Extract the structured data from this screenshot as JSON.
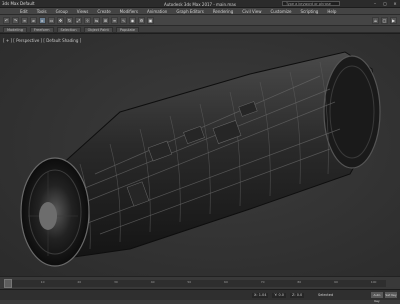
{
  "window": {
    "app_label": "3ds Max Default",
    "title": "Autodesk 3ds Max 2017 - main.max",
    "search_placeholder": "Type a keyword or phrase"
  },
  "menu": {
    "items": [
      "Edit",
      "Tools",
      "Group",
      "Views",
      "Create",
      "Modifiers",
      "Animation",
      "Graph Editors",
      "Rendering",
      "Civil View",
      "Customize",
      "Scripting",
      "Help"
    ]
  },
  "toolbar": {
    "tools": [
      {
        "icon": "undo-icon",
        "glyph": "↶"
      },
      {
        "icon": "redo-icon",
        "glyph": "↷"
      },
      {
        "icon": "link-icon",
        "glyph": "∞"
      },
      {
        "icon": "unlink-icon",
        "glyph": "⌀"
      },
      {
        "icon": "select-icon",
        "glyph": "▸"
      },
      {
        "icon": "select-region-icon",
        "glyph": "▭"
      },
      {
        "icon": "move-icon",
        "glyph": "✥"
      },
      {
        "icon": "rotate-icon",
        "glyph": "↻"
      },
      {
        "icon": "scale-icon",
        "glyph": "⤢"
      },
      {
        "icon": "snap-icon",
        "glyph": "⊹"
      },
      {
        "icon": "mirror-icon",
        "glyph": "⇋"
      },
      {
        "icon": "align-icon",
        "glyph": "⊞"
      },
      {
        "icon": "layer-icon",
        "glyph": "≡"
      },
      {
        "icon": "curve-editor-icon",
        "glyph": "∿"
      },
      {
        "icon": "material-editor-icon",
        "glyph": "◉"
      },
      {
        "icon": "render-setup-icon",
        "glyph": "⚙"
      },
      {
        "icon": "render-icon",
        "glyph": "▣"
      }
    ],
    "right_tools": [
      {
        "icon": "teapot-render-icon",
        "glyph": "☕"
      },
      {
        "icon": "frame-window-icon",
        "glyph": "▢"
      },
      {
        "icon": "quick-render-icon",
        "glyph": "▶"
      }
    ]
  },
  "ribbon": {
    "tabs": [
      "Modeling",
      "Freeform",
      "Selection",
      "Object Paint",
      "Populate"
    ]
  },
  "viewport": {
    "label": "[ + ] [ Perspective ] [ Default Shading ]"
  },
  "timeline": {
    "ticks": [
      "0",
      "10",
      "20",
      "30",
      "40",
      "50",
      "60",
      "70",
      "80",
      "90",
      "100"
    ],
    "slider_label": "0 / 100"
  },
  "status": {
    "x": "X: 1.04",
    "y": "Y: 0.0",
    "z": "Z: 0.0",
    "grid": "Grid = 10.0",
    "selected": "Selected",
    "autokey": "Auto Key",
    "setkey": "Set Key"
  },
  "colors": {
    "background": "#3b3b3b",
    "viewport": "#303030",
    "accent": "#6a7f93"
  }
}
